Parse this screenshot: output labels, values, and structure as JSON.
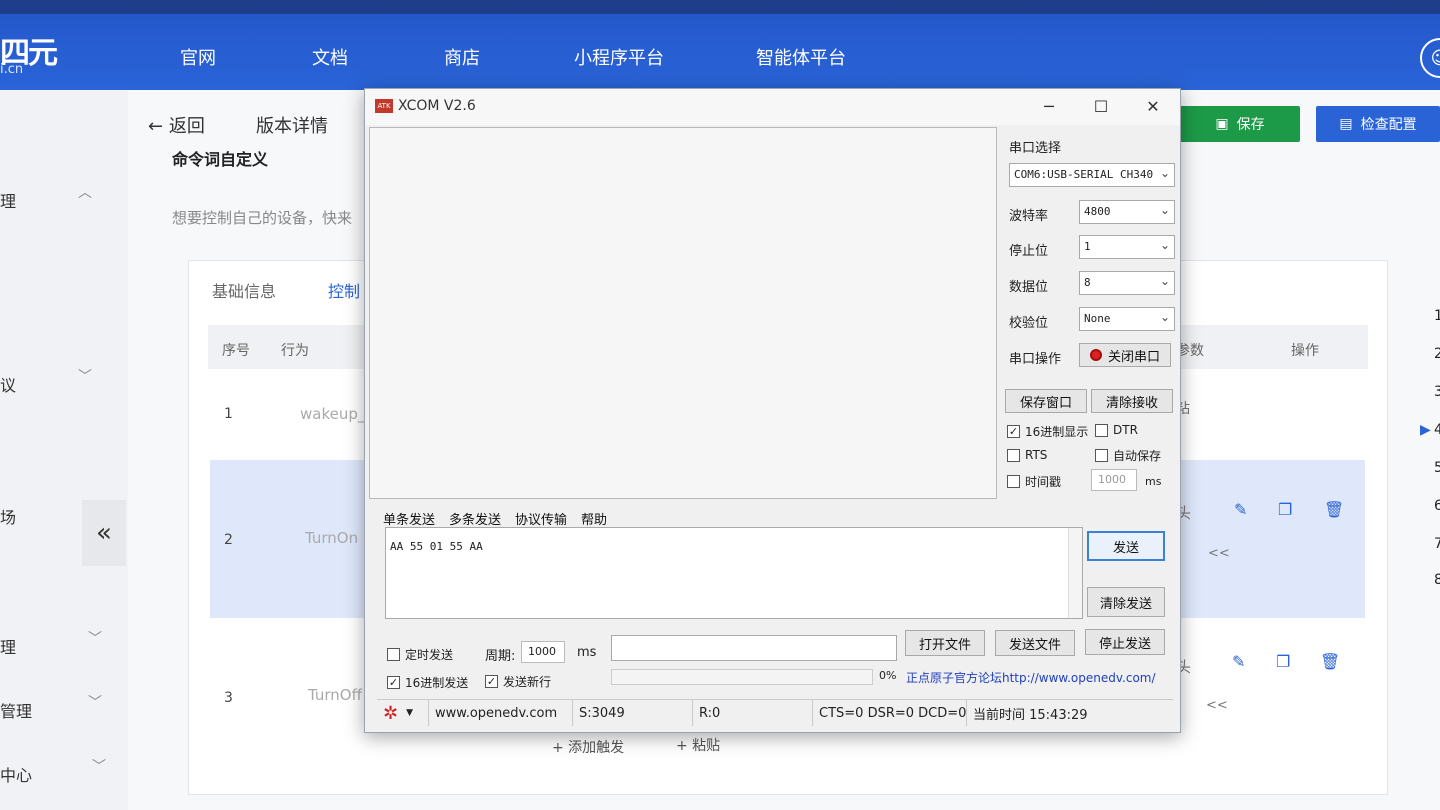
{
  "topnav": {
    "logo": "四元",
    "logo_sub": "i.cn",
    "items": [
      "官网",
      "文档",
      "商店",
      "小程序平台",
      "智能体平台"
    ]
  },
  "sidebar": {
    "items": [
      "理",
      "议",
      "场",
      "理",
      "管理",
      "中心"
    ],
    "collapse": "«"
  },
  "page": {
    "back_label": "返回",
    "crumb": "版本详情",
    "section_title": "命令词自定义",
    "section_desc": "想要控制自己的设备，快来",
    "save_label": "保存",
    "check_label": "检查配置"
  },
  "card": {
    "tabs": [
      "基础信息",
      "控制"
    ],
    "headers": [
      "序号",
      "行为",
      "参数",
      "操作"
    ],
    "rows": [
      {
        "num": "1",
        "behavior": "wakeup_",
        "param": "粘"
      },
      {
        "num": "2",
        "behavior": "TurnOn",
        "param": "头"
      },
      {
        "num": "3",
        "behavior": "TurnOff",
        "param": "头"
      }
    ],
    "collapse_tag": "<<",
    "add_trigger": "+ 添加触发",
    "paste": "+ 粘贴",
    "right_nums": [
      "1",
      "2",
      "3",
      "4",
      "5",
      "6",
      "7",
      "8"
    ]
  },
  "xcom": {
    "title": "XCOM V2.6",
    "port_select_label": "串口选择",
    "port_value": "COM6:USB-SERIAL CH340",
    "baud_label": "波特率",
    "baud_value": "4800",
    "stop_label": "停止位",
    "stop_value": "1",
    "data_label": "数据位",
    "data_value": "8",
    "parity_label": "校验位",
    "parity_value": "None",
    "op_label": "串口操作",
    "close_port": "关闭串口",
    "save_window": "保存窗口",
    "clear_recv": "清除接收",
    "hex_display": "16进制显示",
    "dtr": "DTR",
    "rts": "RTS",
    "auto_save": "自动保存",
    "timestamp": "时间戳",
    "timestamp_value": "1000",
    "ms": "ms",
    "send_tabs": [
      "单条发送",
      "多条发送",
      "协议传输",
      "帮助"
    ],
    "send_text": "AA 55 01 55 AA",
    "send_btn": "发送",
    "clear_send": "清除发送",
    "timed_send": "定时发送",
    "period_label": "周期:",
    "period_value": "1000",
    "open_file": "打开文件",
    "send_file": "发送文件",
    "stop_send": "停止发送",
    "hex_send": "16进制发送",
    "send_newline": "发送新行",
    "progress_pct": "0%",
    "forum_link": "正点原子官方论坛http://www.openedv.com/",
    "status": {
      "url": "www.openedv.com",
      "sent": "S:3049",
      "recv": "R:0",
      "lines": "CTS=0 DSR=0 DCD=0",
      "time": "当前时间 15:43:29"
    }
  }
}
